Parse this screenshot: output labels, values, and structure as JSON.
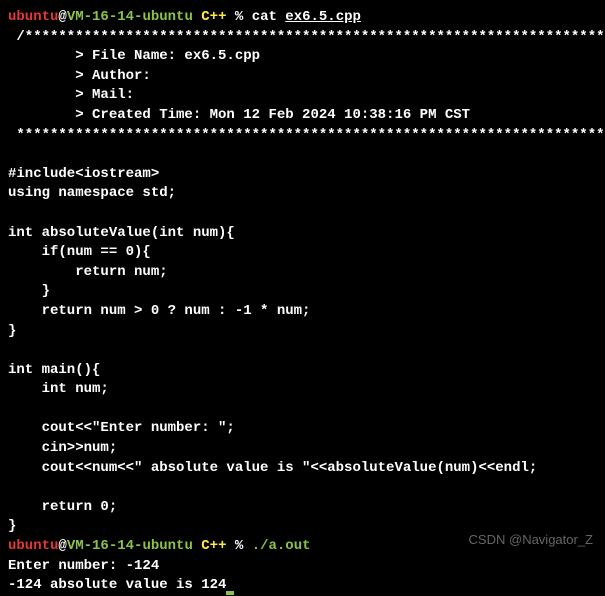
{
  "prompt1": {
    "user": "ubuntu",
    "at": "@",
    "host": "VM-16-14-ubuntu",
    "dir": " C++ ",
    "sep": "% ",
    "cmd": "cat ",
    "arg": "ex6.5.cpp"
  },
  "header": {
    "top": " /*************************************************************************",
    "l1": "        > File Name: ex6.5.cpp",
    "l2": "        > Author:",
    "l3": "        > Mail:",
    "l4": "        > Created Time: Mon 12 Feb 2024 10:38:16 PM CST",
    "bottom": " ************************************************************************/"
  },
  "code": {
    "c01": "#include<iostream>",
    "c02": "using namespace std;",
    "c03": "",
    "c04": "int absoluteValue(int num){",
    "c05": "    if(num == 0){",
    "c06": "        return num;",
    "c07": "    }",
    "c08": "    return num > 0 ? num : -1 * num;",
    "c09": "}",
    "c10": "",
    "c11": "int main(){",
    "c12": "    int num;",
    "c13": "",
    "c14": "    cout<<\"Enter number: \";",
    "c15": "    cin>>num;",
    "c16": "    cout<<num<<\" absolute value is \"<<absoluteValue(num)<<endl;",
    "c17": "",
    "c18": "    return 0;",
    "c19": "}"
  },
  "prompt2": {
    "user": "ubuntu",
    "at": "@",
    "host": "VM-16-14-ubuntu",
    "dir": " C++ ",
    "sep": "% ",
    "cmd": "./a.out"
  },
  "run": {
    "l1": "Enter number: -124",
    "l2": "-124 absolute value is 124"
  },
  "watermark": "CSDN @Navigator_Z"
}
